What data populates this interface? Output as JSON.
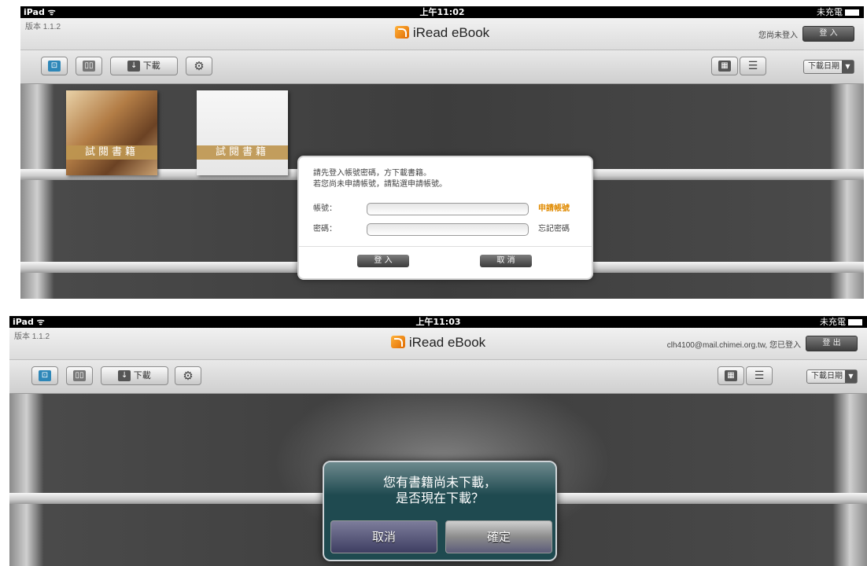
{
  "screen1": {
    "status": {
      "carrier": "iPad ᯤ",
      "time": "上午11:02",
      "battery": "未充電"
    },
    "topbar": {
      "version": "版本 1.1.2",
      "brand": "iRead eBook",
      "user_text": "您尚未登入",
      "auth_button": "登 入"
    },
    "toolbar": {
      "download_label": "下載",
      "sort_label": "下載日期"
    },
    "books": [
      {
        "ribbon": "試閱書籍"
      },
      {
        "ribbon": "試閱書籍"
      }
    ],
    "login_dialog": {
      "message_line1": "請先登入帳號密碼，方下載書籍。",
      "message_line2": "若您尚未申請帳號，請點選申請帳號。",
      "account_label": "帳號：",
      "account_value": "",
      "apply_link": "申請帳號",
      "password_label": "密碼：",
      "password_value": "",
      "forgot_label": "忘記密碼",
      "login_button": "登 入",
      "cancel_button": "取 消"
    }
  },
  "screen2": {
    "status": {
      "carrier": "iPad ᯤ",
      "time": "上午11:03",
      "battery": "未充電"
    },
    "topbar": {
      "version": "版本 1.1.2",
      "brand": "iRead eBook",
      "user_text": "clh4100@mail.chimei.org.tw, 您已登入",
      "auth_button": "登 出"
    },
    "toolbar": {
      "download_label": "下載",
      "sort_label": "下載日期"
    },
    "alert": {
      "line1": "您有書籍尚未下載，",
      "line2": "是否現在下載？",
      "cancel_button": "取消",
      "ok_button": "確定"
    }
  }
}
